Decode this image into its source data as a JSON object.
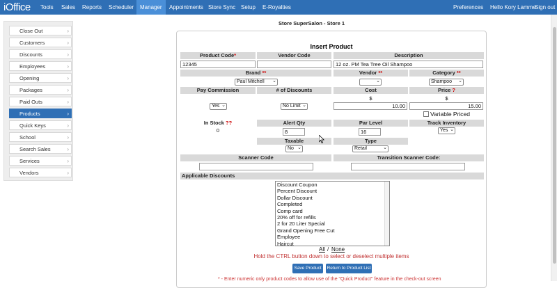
{
  "app": {
    "logo": "iOffice",
    "nav": [
      "Tools",
      "Sales",
      "Reports",
      "Scheduler",
      "Manager",
      "Appointments",
      "Store Sync",
      "Setup",
      "E-Royalties"
    ],
    "active_nav": "Manager",
    "preferences": "Preferences",
    "greeting": "Hello Kory Lamme",
    "sign_out": "Sign out"
  },
  "sidebar": {
    "items": [
      "Close Out",
      "Customers",
      "Discounts",
      "Employees",
      "Opening",
      "Packages",
      "Paid Outs",
      "Products",
      "Quick Keys",
      "School",
      "Search Sales",
      "Services",
      "Vendors"
    ],
    "active": "Products"
  },
  "store_title": "Store SuperSalon - Store 1",
  "form": {
    "title": "Insert Product",
    "headers": {
      "product_code": "Product Code",
      "vendor_code": "Vendor Code",
      "description": "Description",
      "brand": "Brand",
      "vendor": "Vendor",
      "category": "Category",
      "pay_commission": "Pay Commission",
      "num_discounts": "# of Discounts",
      "cost": "Cost",
      "price": "Price",
      "in_stock": "In Stock",
      "alert_qty": "Alert Qty",
      "par_level": "Par Level",
      "track_inventory": "Track Inventory",
      "taxable": "Taxable",
      "type": "Type",
      "scanner_code": "Scanner Code",
      "transition_scanner_code": "Transition Scanner Code:",
      "applicable_discounts": "Applicable Discounts"
    },
    "marks": {
      "required": "*",
      "double_required": "**",
      "question": "?",
      "double_question": "??"
    },
    "values": {
      "product_code": "12345",
      "vendor_code": "",
      "description": "12 oz. PM Tea Tree Oil Shampoo",
      "brand": "Paul Mitchell",
      "vendor": "",
      "category": "Shampoo",
      "pay_commission": "Yes",
      "num_discounts": "No Limit",
      "currency": "$",
      "cost": "10.00",
      "price": "15.00",
      "variable_priced": "Variable Priced",
      "in_stock": "0",
      "alert_qty": "8",
      "par_level": "16",
      "track_inventory": "Yes",
      "taxable": "No",
      "type": "Retail",
      "scanner_code": "",
      "transition_scanner_code": ""
    },
    "discounts": [
      "Discount Coupon",
      "Percent Discount",
      "Dollar Discount",
      "Completed",
      "Comp card",
      "20% off for refills",
      "2 for 20 Liter Special",
      "Grand Opening Free Cut",
      "Employee",
      "Haircut"
    ],
    "select_all": "All",
    "separator": "/",
    "select_none": "None",
    "hint": "Hold the CTRL button down to select or deselect multiple items",
    "save_button": "Save Product",
    "return_button": "Return to Product List",
    "footnote": "* - Enter numeric only product codes to allow use of the \"Quick Product\" feature in the check-out screen"
  }
}
